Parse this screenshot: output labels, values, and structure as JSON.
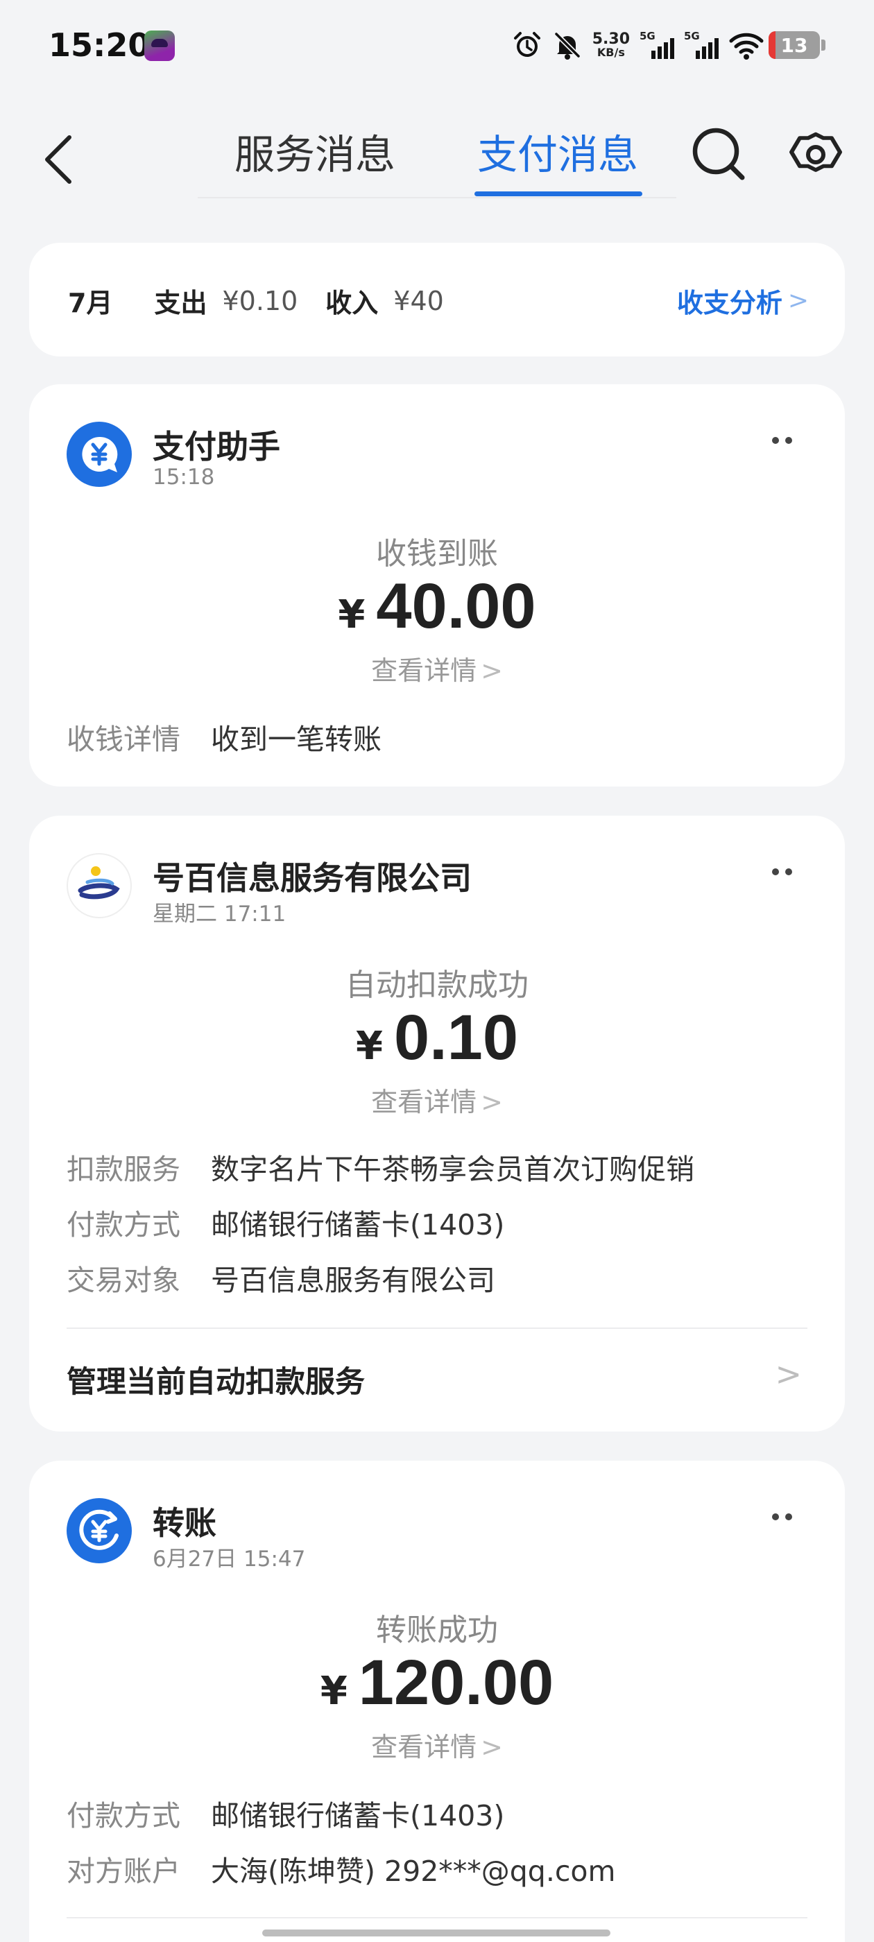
{
  "status_bar": {
    "time": "15:20",
    "speed_value": "5.30",
    "speed_unit": "KB/s",
    "sim1_label": "5G",
    "sim2_label": "5G",
    "battery": "13",
    "icons": [
      "alarm-icon",
      "bell-off-icon",
      "signal-icon",
      "wifi-icon",
      "battery-icon"
    ]
  },
  "nav": {
    "tabs": [
      {
        "label": "服务消息",
        "active": false
      },
      {
        "label": "支付消息",
        "active": true
      }
    ],
    "icons": [
      "back-icon",
      "search-icon",
      "gear-icon"
    ],
    "accent": "#1f6fe0"
  },
  "summary": {
    "month": "7月",
    "expense_label": "支出",
    "expense_value": "¥0.10",
    "income_label": "收入",
    "income_value": "¥40",
    "analysis_label": "收支分析"
  },
  "cards": [
    {
      "title": "支付助手",
      "time": "15:18",
      "status": "收钱到账",
      "currency": "¥",
      "amount": "40.00",
      "detail_link": "查看详情",
      "fields": [
        {
          "key": "收钱详情",
          "value": "收到一笔转账"
        }
      ]
    },
    {
      "title": "号百信息服务有限公司",
      "time": "星期二 17:11",
      "status": "自动扣款成功",
      "currency": "¥",
      "amount": "0.10",
      "detail_link": "查看详情",
      "fields": [
        {
          "key": "扣款服务",
          "value": "数字名片下午茶畅享会员首次订购促销"
        },
        {
          "key": "付款方式",
          "value": "邮储银行储蓄卡(1403)"
        },
        {
          "key": "交易对象",
          "value": "号百信息服务有限公司"
        }
      ],
      "action": "管理当前自动扣款服务"
    },
    {
      "title": "转账",
      "time": "6月27日 15:47",
      "status": "转账成功",
      "currency": "¥",
      "amount": "120.00",
      "detail_link": "查看详情",
      "fields": [
        {
          "key": "付款方式",
          "value": "邮储银行储蓄卡(1403)"
        },
        {
          "key": "对方账户",
          "value": "大海(陈坤赞) 292***@qq.com"
        }
      ]
    }
  ]
}
